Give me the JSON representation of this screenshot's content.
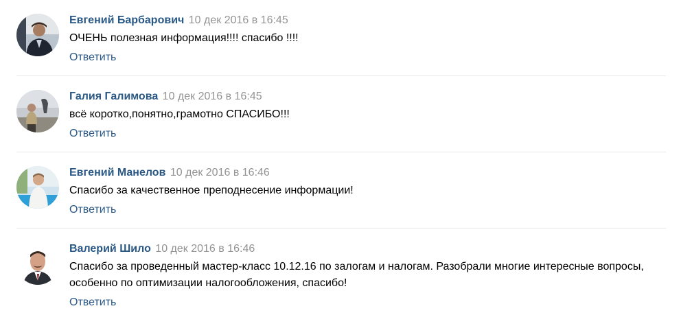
{
  "comments": [
    {
      "author": "Евгений Барбарович",
      "date": "10 дек 2016 в 16:45",
      "text": "ОЧЕНЬ полезная информация!!!! спасибо !!!!",
      "reply_label": "Ответить"
    },
    {
      "author": "Галия Галимова",
      "date": "10 дек 2016 в 16:45",
      "text": "всё коротко,понятно,грамотно СПАСИБО!!!",
      "reply_label": "Ответить"
    },
    {
      "author": "Евгений Манелов",
      "date": "10 дек 2016 в 16:46",
      "text": "Спасибо за качественное преподнесение информации!",
      "reply_label": "Ответить"
    },
    {
      "author": "Валерий Шило",
      "date": "10 дек 2016 в 16:46",
      "text": "Спасибо за проведенный мастер-класс 10.12.16 по залогам и налогам. Разобрали многие интересные вопросы, особенно по оптимизации налогообложения, спасибо!",
      "reply_label": "Ответить"
    }
  ],
  "colors": {
    "author": "#2a5885",
    "date": "#939393",
    "reply": "#2a5885",
    "divider": "#e7e8ec"
  }
}
